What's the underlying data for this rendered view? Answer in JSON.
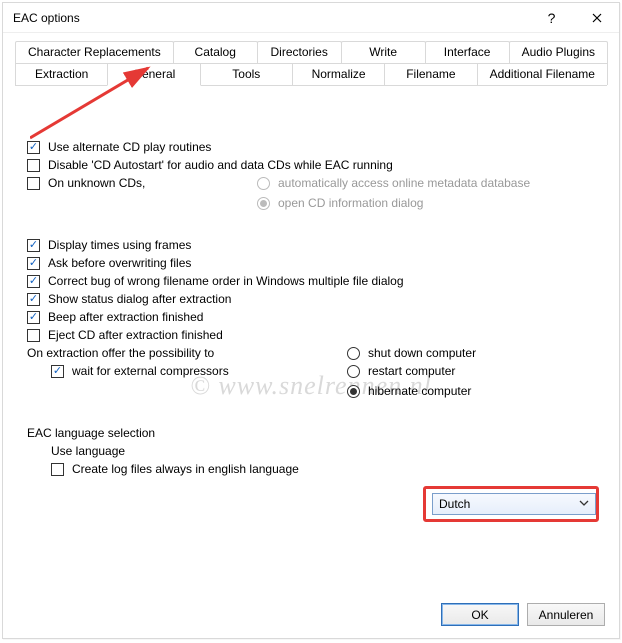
{
  "window": {
    "title": "EAC options"
  },
  "tabs": {
    "row1": [
      "Character Replacements",
      "Catalog",
      "Directories",
      "Write",
      "Interface",
      "Audio Plugins"
    ],
    "row2": [
      "Extraction",
      "General",
      "Tools",
      "Normalize",
      "Filename",
      "Additional Filename"
    ],
    "active": "General"
  },
  "opts": {
    "alt_routines": "Use alternate CD play routines",
    "disable_autostart": "Disable 'CD Autostart' for audio and data CDs while EAC running",
    "unknown_cds": "On unknown CDs,",
    "unknown_auto": "automatically access online metadata database",
    "unknown_open": "open CD information dialog",
    "disp_frames": "Display times using frames",
    "ask_overwrite": "Ask before overwriting files",
    "correct_bug": "Correct bug of wrong filename order in Windows multiple file dialog",
    "show_status": "Show status dialog after extraction",
    "beep": "Beep after extraction finished",
    "eject": "Eject CD after extraction finished",
    "on_extract_offer": "On extraction offer the possibility to",
    "wait_comp": "wait for external compressors",
    "shutdown": "shut down computer",
    "restart": "restart computer",
    "hibernate": "hibernate computer",
    "lang_section": "EAC language selection",
    "use_lang": "Use language",
    "log_english": "Create log files always in english language"
  },
  "select": {
    "language": "Dutch"
  },
  "buttons": {
    "ok": "OK",
    "cancel": "Annuleren"
  },
  "watermark": "© www.snelrennen.nl"
}
